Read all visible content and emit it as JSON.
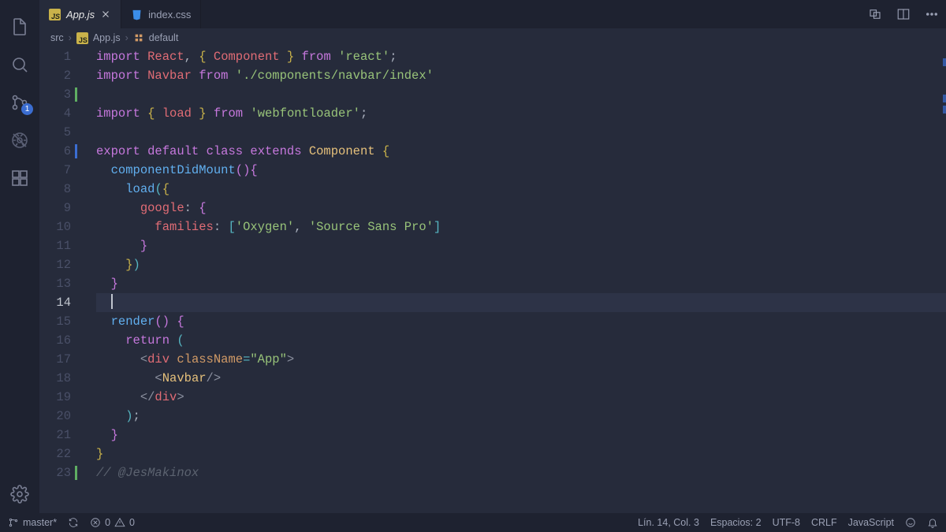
{
  "tabs": [
    {
      "label": "App.js",
      "icon": "js",
      "active": true,
      "dirty": false
    },
    {
      "label": "index.css",
      "icon": "css",
      "active": false,
      "dirty": false
    }
  ],
  "breadcrumbs": {
    "folder": "src",
    "file": "App.js",
    "symbol": "default"
  },
  "scm_badge": "1",
  "editor": {
    "lines": [
      {
        "n": 1,
        "mark": "",
        "html": "<span class='kw'>import</span> <span class='def'>React</span><span class='p'>,</span> <span class='pb'>{</span> <span class='def'>Component</span> <span class='pb'>}</span> <span class='kw'>from</span> <span class='str'>'react'</span><span class='p'>;</span>"
      },
      {
        "n": 2,
        "mark": "",
        "html": "<span class='kw'>import</span> <span class='def'>Navbar</span> <span class='kw'>from</span> <span class='str'>'./components/navbar/index'</span>"
      },
      {
        "n": 3,
        "mark": "add",
        "html": ""
      },
      {
        "n": 4,
        "mark": "",
        "html": "<span class='kw'>import</span> <span class='pb'>{</span> <span class='def'>load</span> <span class='pb'>}</span> <span class='kw'>from</span> <span class='str'>'webfontloader'</span><span class='p'>;</span>"
      },
      {
        "n": 5,
        "mark": "",
        "html": ""
      },
      {
        "n": 6,
        "mark": "mod",
        "html": "<span class='kw'>export</span> <span class='kw'>default</span> <span class='kw'>class</span> <span class='kw'>extends</span> <span class='cls'>Component</span> <span class='pb'>{</span>"
      },
      {
        "n": 7,
        "mark": "",
        "html": "  <span class='fn'>componentDidMount</span><span class='pp'>(</span><span class='pp'>)</span><span class='pp'>{</span>"
      },
      {
        "n": 8,
        "mark": "",
        "html": "    <span class='fn'>load</span><span class='pc'>(</span><span class='pb'>{</span>"
      },
      {
        "n": 9,
        "mark": "",
        "html": "      <span class='prop'>google</span><span class='p'>:</span> <span class='pp'>{</span>"
      },
      {
        "n": 10,
        "mark": "",
        "html": "        <span class='prop'>families</span><span class='p'>:</span> <span class='pc'>[</span><span class='str'>'Oxygen'</span><span class='p'>,</span> <span class='str'>'Source Sans Pro'</span><span class='pc'>]</span>"
      },
      {
        "n": 11,
        "mark": "",
        "html": "      <span class='pp'>}</span>"
      },
      {
        "n": 12,
        "mark": "",
        "html": "    <span class='pb'>}</span><span class='pc'>)</span>"
      },
      {
        "n": 13,
        "mark": "",
        "html": "  <span class='pp'>}</span>"
      },
      {
        "n": 14,
        "mark": "",
        "active": true,
        "html": "  <span class='cursor'></span>"
      },
      {
        "n": 15,
        "mark": "",
        "html": "  <span class='fn'>render</span><span class='pp'>(</span><span class='pp'>)</span> <span class='pp'>{</span>"
      },
      {
        "n": 16,
        "mark": "",
        "html": "    <span class='kw'>return</span> <span class='pc'>(</span>"
      },
      {
        "n": 17,
        "mark": "",
        "html": "      <span class='jsxb'>&lt;</span><span class='tag'>div</span> <span class='attr'>className</span><span class='op'>=</span><span class='str'>\"App\"</span><span class='jsxb'>&gt;</span>"
      },
      {
        "n": 18,
        "mark": "",
        "html": "        <span class='jsxb'>&lt;</span><span class='cls'>Navbar</span><span class='jsxb'>/&gt;</span>"
      },
      {
        "n": 19,
        "mark": "",
        "html": "      <span class='jsxb'>&lt;/</span><span class='tag'>div</span><span class='jsxb'>&gt;</span>"
      },
      {
        "n": 20,
        "mark": "",
        "html": "    <span class='pc'>)</span><span class='p'>;</span>"
      },
      {
        "n": 21,
        "mark": "",
        "html": "  <span class='pp'>}</span>"
      },
      {
        "n": 22,
        "mark": "",
        "html": "<span class='pb'>}</span>"
      },
      {
        "n": 23,
        "mark": "add",
        "html": "<span class='com'>// @JesMakinox</span>"
      }
    ]
  },
  "status": {
    "branch": "master*",
    "errors": "0",
    "warnings": "0",
    "pos": "Lín. 14, Col. 3",
    "indent": "Espacios: 2",
    "encoding": "UTF-8",
    "eol": "CRLF",
    "lang": "JavaScript"
  }
}
